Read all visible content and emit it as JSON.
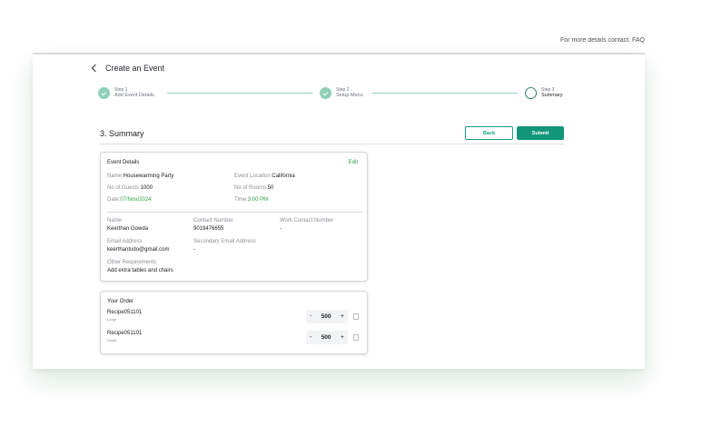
{
  "top_note": "For more details contact: FAQ",
  "header": {
    "title": "Create an Event"
  },
  "stepper": {
    "steps": [
      {
        "num": "Step 1",
        "label": "Add Event Details",
        "state": "done"
      },
      {
        "num": "Step 2",
        "label": "Setup Menu",
        "state": "done"
      },
      {
        "num": "Step 3",
        "label": "Summary",
        "state": "current"
      }
    ]
  },
  "summary": {
    "title": "3. Summary",
    "back_label": "Back",
    "submit_label": "Submit"
  },
  "event_details": {
    "title": "Event Details",
    "edit_label": "Edit",
    "name_key": "Name:",
    "name_val": "Housewarming Party",
    "location_key": "Event Location:",
    "location_val": "California",
    "guests_key": "No of Guests:",
    "guests_val": "1000",
    "rooms_key": "No of Rooms:",
    "rooms_val": "50",
    "date_key": "Date:",
    "date_val": "07/Nov/2024",
    "time_key": "Time:",
    "time_val": "3:00 PM",
    "contact_name_label": "Name",
    "contact_name": "Keerthan Gowda",
    "contact_number_label": "Contact Number",
    "contact_number": "9019476655",
    "work_contact_label": "Work Contact Number",
    "work_contact": "-",
    "email_label": "Email Address",
    "email": "keerthantudo@gmail.com",
    "secondary_email_label": "Secondary Email Address",
    "secondary_email": "-",
    "requirements_label": "Other Requirements",
    "requirements": "Add extra tables and chairs"
  },
  "order": {
    "title": "Your Order",
    "items": [
      {
        "name": "Recipe051101",
        "size": "Large",
        "qty": "500"
      },
      {
        "name": "Recipe051101",
        "size": "Small",
        "qty": "500"
      }
    ],
    "minus": "-",
    "plus": "+"
  },
  "colors": {
    "accent": "#13967a",
    "step_done": "#8fd0b8",
    "highlight_green": "#2e9d40"
  }
}
